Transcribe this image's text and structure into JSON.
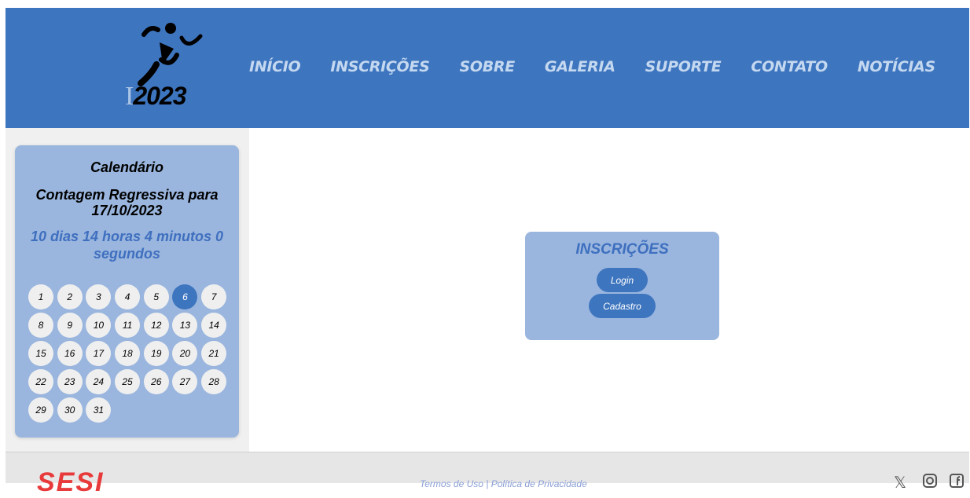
{
  "logo": {
    "prefix": "I",
    "year": "2023"
  },
  "nav": [
    "INÍCIO",
    "INSCRIÇÕES",
    "SOBRE",
    "GALERIA",
    "SUPORTE",
    "CONTATO",
    "NOTÍCIAS"
  ],
  "calendar": {
    "title": "Calendário",
    "subtitle": "Contagem Regressiva para 17/10/2023",
    "countdown": "10 dias 14 horas 4 minutos 0 segundos",
    "days": [
      "1",
      "2",
      "3",
      "4",
      "5",
      "6",
      "7",
      "8",
      "9",
      "10",
      "11",
      "12",
      "13",
      "14",
      "15",
      "16",
      "17",
      "18",
      "19",
      "20",
      "21",
      "22",
      "23",
      "24",
      "25",
      "26",
      "27",
      "28",
      "29",
      "30",
      "31"
    ],
    "active_day": "6"
  },
  "inscricoes": {
    "title": "INSCRIÇÕES",
    "login_label": "Login",
    "cadastro_label": "Cadastro"
  },
  "footer": {
    "brand": "SESI",
    "links": "Termos de Uso | Política de Privacidade",
    "social_icons": [
      "x-icon",
      "instagram-icon",
      "facebook-icon"
    ]
  },
  "colors": {
    "primary": "#3e75bf",
    "card": "#9ab6de",
    "nav_text": "#c4d8f0"
  }
}
